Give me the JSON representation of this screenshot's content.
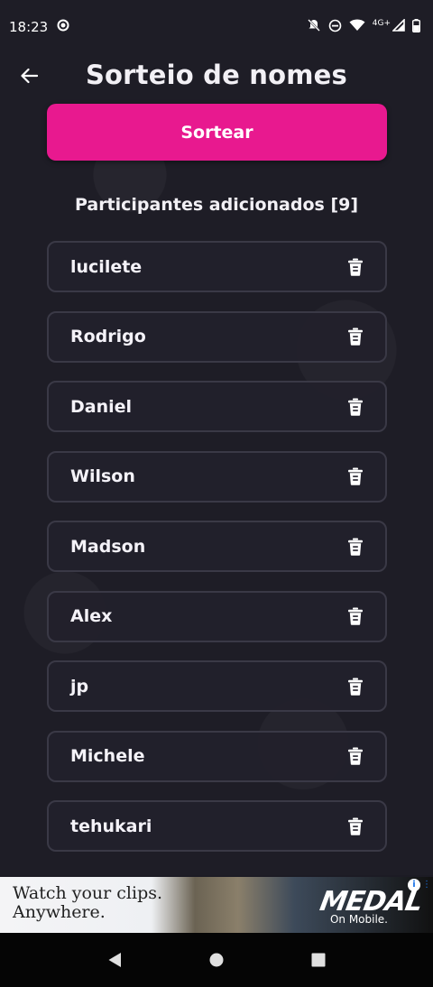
{
  "status_bar": {
    "time": "18:23",
    "network": "4G+",
    "icons": [
      "recording-icon",
      "notifications-off-icon",
      "do-not-disturb-icon",
      "wifi-icon",
      "signal-icon",
      "battery-icon"
    ]
  },
  "header": {
    "title": "Sorteio de nomes",
    "back_icon": "arrow-left-icon"
  },
  "draw_button": {
    "label": "Sortear",
    "color": "#e8198f"
  },
  "participants": {
    "heading": "Participantes adicionados [9]",
    "items": [
      {
        "name": "lucilete"
      },
      {
        "name": "Rodrigo"
      },
      {
        "name": "Daniel"
      },
      {
        "name": "Wilson"
      },
      {
        "name": "Madson"
      },
      {
        "name": "Alex"
      },
      {
        "name": "jp"
      },
      {
        "name": "Michele"
      },
      {
        "name": "tehukari"
      }
    ],
    "delete_icon": "trash-icon"
  },
  "ad": {
    "line1": "Watch your clips.",
    "line2": "Anywhere.",
    "brand": "MEDAL",
    "tagline": "On Mobile."
  },
  "nav_bar": {
    "icons": [
      "back-triangle-icon",
      "home-circle-icon",
      "recents-square-icon"
    ]
  }
}
